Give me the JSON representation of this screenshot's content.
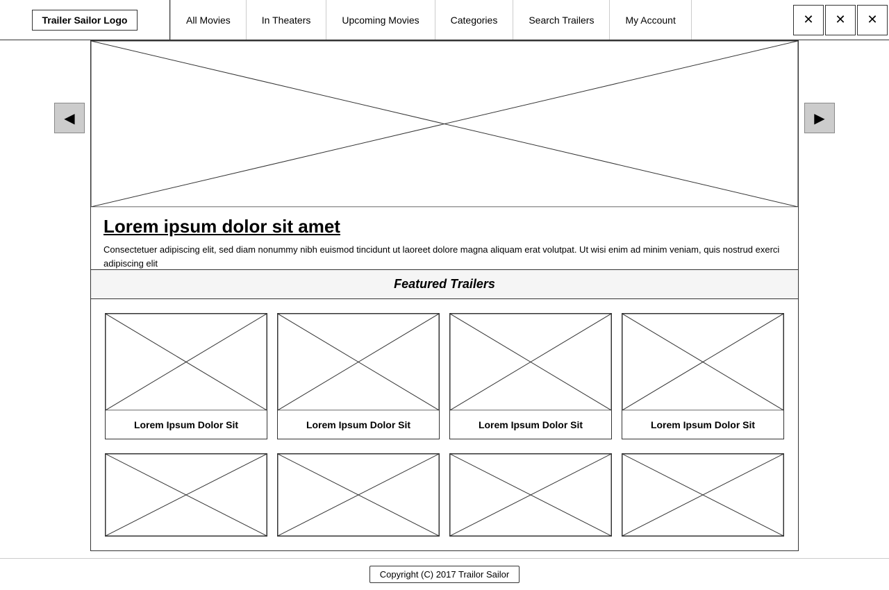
{
  "nav": {
    "logo_label": "Trailer Sailor Logo",
    "links": [
      {
        "id": "all-movies",
        "label": "All Movies"
      },
      {
        "id": "in-theaters",
        "label": "In Theaters"
      },
      {
        "id": "upcoming-movies",
        "label": "Upcoming Movies"
      },
      {
        "id": "categories",
        "label": "Categories"
      },
      {
        "id": "search-trailers",
        "label": "Search Trailers"
      },
      {
        "id": "my-account",
        "label": "My Account"
      }
    ],
    "icons": [
      "✕",
      "✕",
      "✕"
    ]
  },
  "hero": {
    "title": "Lorem ipsum dolor sit amet",
    "description": "Consectetuer adipiscing elit, sed diam nonummy nibh euismod tincidunt ut laoreet dolore magna aliquam erat volutpat. Ut wisi enim ad minim veniam, quis nostrud exerci adipiscing elit",
    "prev_label": "◀",
    "next_label": "▶"
  },
  "featured": {
    "heading": "Featured Trailers",
    "cards": [
      {
        "id": "card-1",
        "label": "Lorem Ipsum Dolor Sit"
      },
      {
        "id": "card-2",
        "label": "Lorem Ipsum Dolor Sit"
      },
      {
        "id": "card-3",
        "label": "Lorem Ipsum Dolor Sit"
      },
      {
        "id": "card-4",
        "label": "Lorem Ipsum Dolor Sit"
      }
    ],
    "partial_cards": [
      {
        "id": "partial-1"
      },
      {
        "id": "partial-2"
      },
      {
        "id": "partial-3"
      },
      {
        "id": "partial-4"
      }
    ]
  },
  "footer": {
    "copyright": "Copyright (C) 2017 Trailor Sailor"
  }
}
